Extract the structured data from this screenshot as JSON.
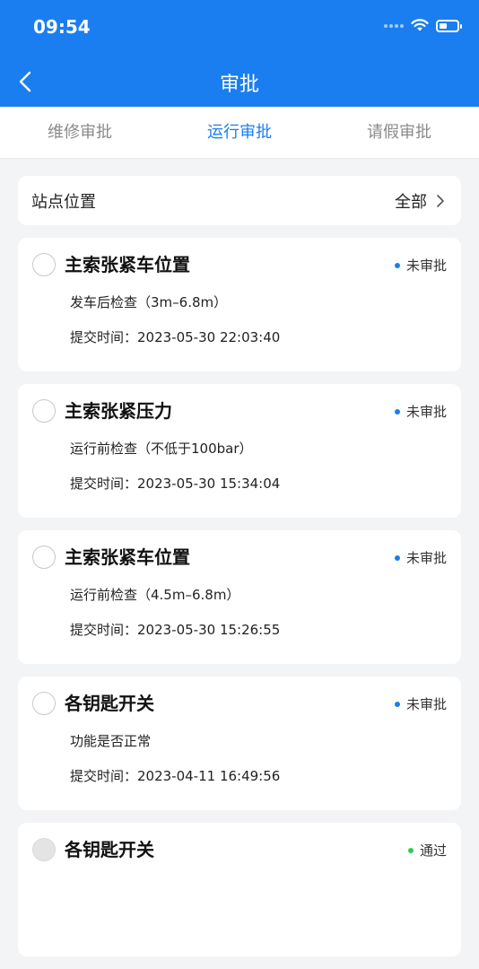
{
  "status_bar": {
    "time": "09:54"
  },
  "header": {
    "title": "审批"
  },
  "tabs": [
    {
      "label": "维修审批",
      "active": false
    },
    {
      "label": "运行审批",
      "active": true
    },
    {
      "label": "请假审批",
      "active": false
    }
  ],
  "filter": {
    "label": "站点位置",
    "value": "全部"
  },
  "colors": {
    "brand": "#1a7ef0",
    "pending": "#1a7ef0",
    "approved": "#34c759"
  },
  "items": [
    {
      "title": "主索张紧车位置",
      "detail": "发车后检查（3m–6.8m）",
      "submit_time": "提交时间：2023-05-30 22:03:40",
      "status": "未审批"
    },
    {
      "title": "主索张紧压力",
      "detail": "运行前检查（不低于100bar）",
      "submit_time": "提交时间：2023-05-30 15:34:04",
      "status": "未审批"
    },
    {
      "title": "主索张紧车位置",
      "detail": "运行前检查（4.5m–6.8m）",
      "submit_time": "提交时间：2023-05-30 15:26:55",
      "status": "未审批"
    },
    {
      "title": "各钥匙开关",
      "detail": "功能是否正常",
      "submit_time": "提交时间：2023-04-11 16:49:56",
      "status": "未审批"
    },
    {
      "title": "各钥匙开关",
      "detail": "",
      "submit_time": "",
      "status": "通过"
    }
  ]
}
